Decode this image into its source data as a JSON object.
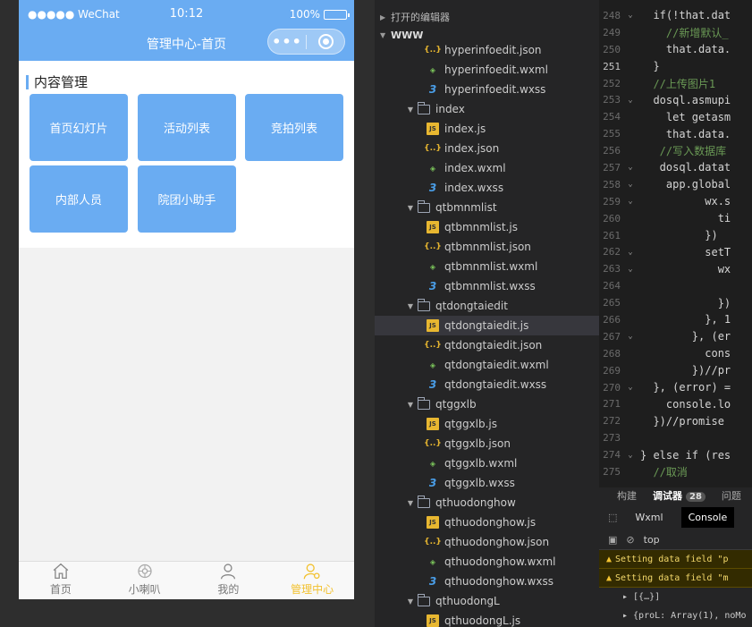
{
  "phone": {
    "status": {
      "signal": "●●●●● WeChat",
      "time": "10:12",
      "battery": "100%"
    },
    "nav_title": "管理中心-首页",
    "capsule_more": "•••",
    "section_title": "内容管理",
    "tiles": [
      "首页幻灯片",
      "活动列表",
      "竞拍列表",
      "内部人员",
      "院团小助手"
    ],
    "tabs": [
      {
        "label": "首页",
        "icon": "home-icon"
      },
      {
        "label": "小喇叭",
        "icon": "horn-icon"
      },
      {
        "label": "我的",
        "icon": "user-icon"
      },
      {
        "label": "管理中心",
        "icon": "admin-icon",
        "active": true
      }
    ],
    "colors": {
      "primary": "#6aacf2",
      "tab_active": "#f2c12e"
    }
  },
  "tree": {
    "open_editors": "打开的编辑器",
    "root": "WWW",
    "rows": [
      {
        "type": "json",
        "name": "hyperinfoedit.json",
        "indent": 2
      },
      {
        "type": "wxml",
        "name": "hyperinfoedit.wxml",
        "indent": 2
      },
      {
        "type": "wxss",
        "name": "hyperinfoedit.wxss",
        "indent": 2
      },
      {
        "type": "folder",
        "name": "index",
        "indent": 1
      },
      {
        "type": "js",
        "name": "index.js",
        "indent": 2
      },
      {
        "type": "json",
        "name": "index.json",
        "indent": 2
      },
      {
        "type": "wxml",
        "name": "index.wxml",
        "indent": 2
      },
      {
        "type": "wxss",
        "name": "index.wxss",
        "indent": 2
      },
      {
        "type": "folder",
        "name": "qtbmnmlist",
        "indent": 1
      },
      {
        "type": "js",
        "name": "qtbmnmlist.js",
        "indent": 2
      },
      {
        "type": "json",
        "name": "qtbmnmlist.json",
        "indent": 2
      },
      {
        "type": "wxml",
        "name": "qtbmnmlist.wxml",
        "indent": 2
      },
      {
        "type": "wxss",
        "name": "qtbmnmlist.wxss",
        "indent": 2
      },
      {
        "type": "folder",
        "name": "qtdongtaiedit",
        "indent": 1
      },
      {
        "type": "js",
        "name": "qtdongtaiedit.js",
        "indent": 2,
        "selected": true
      },
      {
        "type": "json",
        "name": "qtdongtaiedit.json",
        "indent": 2
      },
      {
        "type": "wxml",
        "name": "qtdongtaiedit.wxml",
        "indent": 2
      },
      {
        "type": "wxss",
        "name": "qtdongtaiedit.wxss",
        "indent": 2
      },
      {
        "type": "folder",
        "name": "qtggxlb",
        "indent": 1
      },
      {
        "type": "js",
        "name": "qtggxlb.js",
        "indent": 2
      },
      {
        "type": "json",
        "name": "qtggxlb.json",
        "indent": 2
      },
      {
        "type": "wxml",
        "name": "qtggxlb.wxml",
        "indent": 2
      },
      {
        "type": "wxss",
        "name": "qtggxlb.wxss",
        "indent": 2
      },
      {
        "type": "folder",
        "name": "qthuodonghow",
        "indent": 1
      },
      {
        "type": "js",
        "name": "qthuodonghow.js",
        "indent": 2
      },
      {
        "type": "json",
        "name": "qthuodonghow.json",
        "indent": 2
      },
      {
        "type": "wxml",
        "name": "qthuodonghow.wxml",
        "indent": 2
      },
      {
        "type": "wxss",
        "name": "qthuodonghow.wxss",
        "indent": 2
      },
      {
        "type": "folder",
        "name": "qthuodongL",
        "indent": 1
      },
      {
        "type": "js",
        "name": "qthuodongL.js",
        "indent": 2
      }
    ]
  },
  "editor": {
    "current_line": 251,
    "lines": [
      {
        "n": 248,
        "fold": "⌄",
        "text": "  if(!that.dat"
      },
      {
        "n": 249,
        "fold": "",
        "text": "    //新增默认_"
      },
      {
        "n": 250,
        "fold": "",
        "text": "    that.data."
      },
      {
        "n": 251,
        "fold": "",
        "text": "  }"
      },
      {
        "n": 252,
        "fold": "",
        "text": "  //上传图片1"
      },
      {
        "n": 253,
        "fold": "⌄",
        "text": "  dosql.asmupi"
      },
      {
        "n": 254,
        "fold": "",
        "text": "    let getasm"
      },
      {
        "n": 255,
        "fold": "",
        "text": "    that.data."
      },
      {
        "n": 256,
        "fold": "",
        "text": "   //写入数据库"
      },
      {
        "n": 257,
        "fold": "⌄",
        "text": "   dosql.datat"
      },
      {
        "n": 258,
        "fold": "⌄",
        "text": "    app.global"
      },
      {
        "n": 259,
        "fold": "⌄",
        "text": "          wx.s"
      },
      {
        "n": 260,
        "fold": "",
        "text": "            ti"
      },
      {
        "n": 261,
        "fold": "",
        "text": "          })"
      },
      {
        "n": 262,
        "fold": "⌄",
        "text": "          setT"
      },
      {
        "n": 263,
        "fold": "⌄",
        "text": "            wx"
      },
      {
        "n": 264,
        "fold": "",
        "text": "            "
      },
      {
        "n": 265,
        "fold": "",
        "text": "            })"
      },
      {
        "n": 266,
        "fold": "",
        "text": "          }, 1"
      },
      {
        "n": 267,
        "fold": "⌄",
        "text": "        }, (er"
      },
      {
        "n": 268,
        "fold": "",
        "text": "          cons"
      },
      {
        "n": 269,
        "fold": "",
        "text": "        })//pr"
      },
      {
        "n": 270,
        "fold": "⌄",
        "text": "  }, (error) ="
      },
      {
        "n": 271,
        "fold": "",
        "text": "    console.lo"
      },
      {
        "n": 272,
        "fold": "",
        "text": "  })//promise"
      },
      {
        "n": 273,
        "fold": "",
        "text": ""
      },
      {
        "n": 274,
        "fold": "⌄",
        "text": "} else if (res"
      },
      {
        "n": 275,
        "fold": "",
        "text": "  //取消"
      }
    ]
  },
  "debug": {
    "tabs": [
      "构建",
      "调试器",
      "问题"
    ],
    "badge": "28",
    "sub_tabs": [
      "Wxml",
      "Console"
    ],
    "context": "top",
    "console": [
      {
        "kind": "warn",
        "text": "Setting data field \"p"
      },
      {
        "kind": "warn",
        "text": "Setting data field \"m"
      },
      {
        "kind": "log",
        "text": "▸ [{…}]"
      },
      {
        "kind": "log",
        "text": "▸ {proL: Array(1), noMo"
      }
    ]
  }
}
